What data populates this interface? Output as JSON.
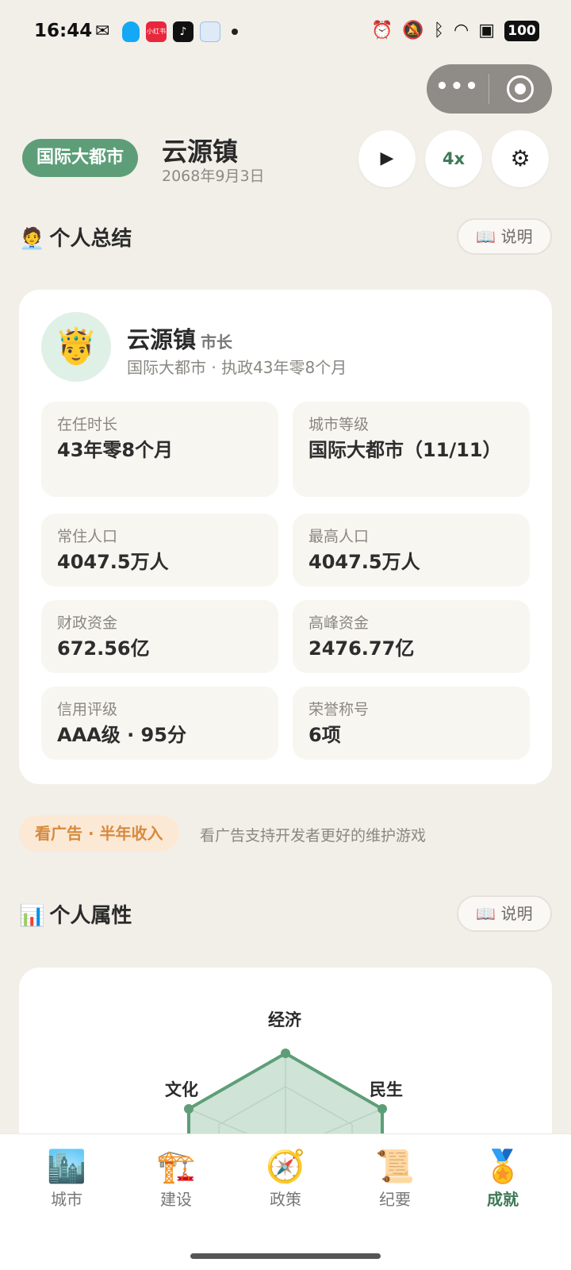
{
  "status_bar": {
    "time": "16:44",
    "notif_icons": [
      "wechat-icon",
      "qq-icon",
      "xiaohongshu-icon",
      "douyin-icon",
      "bilibili-icon"
    ],
    "red_app_text": "小红书",
    "battery": "100"
  },
  "header": {
    "level_badge": "国际大都市",
    "city_name": "云源镇",
    "date": "2068年9月3日",
    "play_label": "▶",
    "speed_label": "4x",
    "settings_label": "⚙"
  },
  "summary_section": {
    "emoji": "🧑‍💼",
    "title": "个人总结",
    "help_label": "📖 说明"
  },
  "profile": {
    "avatar": "🤴",
    "name": "云源镇",
    "title": "市长",
    "subtitle": "国际大都市 · 执政43年零8个月"
  },
  "stats": [
    {
      "label": "在任时长",
      "value": "43年零8个月"
    },
    {
      "label": "城市等级",
      "value": "国际大都市（11/11）"
    },
    {
      "label": "常住人口",
      "value": "4047.5万人"
    },
    {
      "label": "最高人口",
      "value": "4047.5万人"
    },
    {
      "label": "财政资金",
      "value": "672.56亿"
    },
    {
      "label": "高峰资金",
      "value": "2476.77亿"
    },
    {
      "label": "信用评级",
      "value": "AAA级 · 95分"
    },
    {
      "label": "荣誉称号",
      "value": "6项"
    }
  ],
  "ad": {
    "button": "看广告 · 半年收入",
    "text": "看广告支持开发者更好的维护游戏"
  },
  "attributes_section": {
    "emoji": "📊",
    "title": "个人属性",
    "help_label": "📖 说明"
  },
  "radar": {
    "labels": [
      "经济",
      "民生",
      "文化"
    ],
    "colors": {
      "fill": "#cfe3d6",
      "stroke": "#5d9e78"
    }
  },
  "nav": {
    "items": [
      {
        "icon": "🏙️",
        "label": "城市"
      },
      {
        "icon": "🏗️",
        "label": "建设"
      },
      {
        "icon": "🧭",
        "label": "政策"
      },
      {
        "icon": "📜",
        "label": "纪要"
      },
      {
        "icon": "🏅",
        "label": "成就"
      }
    ],
    "active_color": "#3d7a55"
  }
}
